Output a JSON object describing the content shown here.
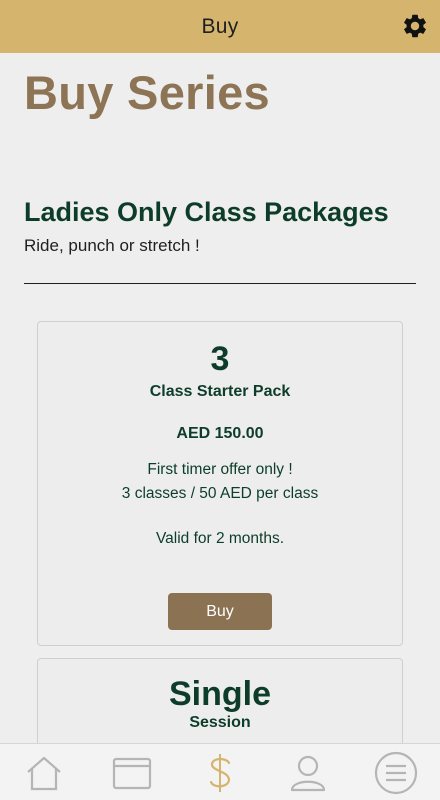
{
  "header": {
    "title": "Buy",
    "settings_icon": "gear-icon"
  },
  "page": {
    "title": "Buy Series"
  },
  "section": {
    "title": "Ladies Only Class Packages",
    "subtitle": "Ride, punch or stretch !"
  },
  "packages": [
    {
      "quantity": "3",
      "name": "Class Starter Pack",
      "price": "AED 150.00",
      "desc_line1": "First timer offer only !",
      "desc_line2": "3 classes / 50 AED per class",
      "validity": "Valid for 2 months.",
      "button_label": "Buy"
    },
    {
      "quantity": "Single",
      "name": "Session"
    }
  ],
  "tabbar": {
    "items": [
      "home-icon",
      "calendar-icon",
      "dollar-icon",
      "profile-icon",
      "menu-icon"
    ],
    "active": "dollar-icon"
  },
  "colors": {
    "header_bg": "#d5b46e",
    "title_brown": "#8c7454",
    "dark_green": "#0d3d2a",
    "button_bg": "#8a7252",
    "active_tab": "#d5b46e",
    "inactive_tab": "#b5b5b5"
  }
}
